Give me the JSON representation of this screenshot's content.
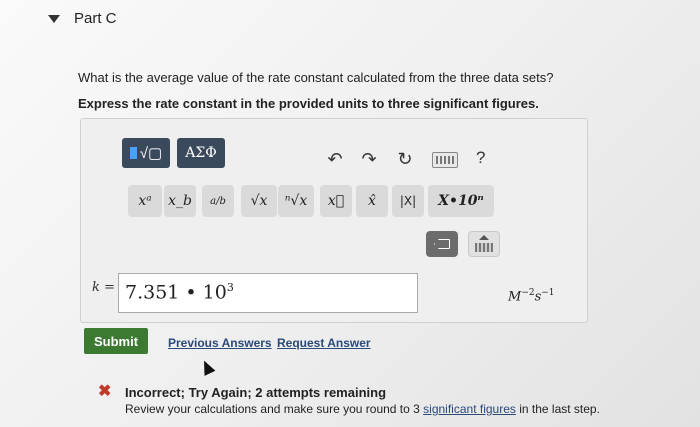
{
  "part": {
    "title": "Part C"
  },
  "question": {
    "text": "What is the average value of the rate constant calculated from the three data sets?",
    "instruction": "Express the rate constant in the provided units to three significant figures."
  },
  "toolbar": {
    "greek_label": "ΑΣΦ",
    "help_label": "?",
    "symbols": {
      "x_power": "xᵃ",
      "x_sub": "x_b",
      "fraction": "a/b",
      "sqrt": "√x",
      "nroot": "ⁿ√x",
      "vector": "x⃗",
      "hat": "x̂",
      "abs": "|X|",
      "sci": "X•10ⁿ"
    }
  },
  "answer": {
    "variable": "k =",
    "mantissa": "7.351 • 10",
    "exponent": "3",
    "units_base": "M",
    "units_exp1": "−2",
    "units_mid": "s",
    "units_exp2": "−1"
  },
  "actions": {
    "submit": "Submit",
    "previous": "Previous Answers",
    "request": "Request Answer"
  },
  "feedback": {
    "status": "Incorrect; Try Again; 2 attempts remaining",
    "body_pre": "Review your calculations and make sure you round to 3 ",
    "body_link": "significant figures",
    "body_post": " in the last step.",
    "status_color": "#c0392b"
  }
}
